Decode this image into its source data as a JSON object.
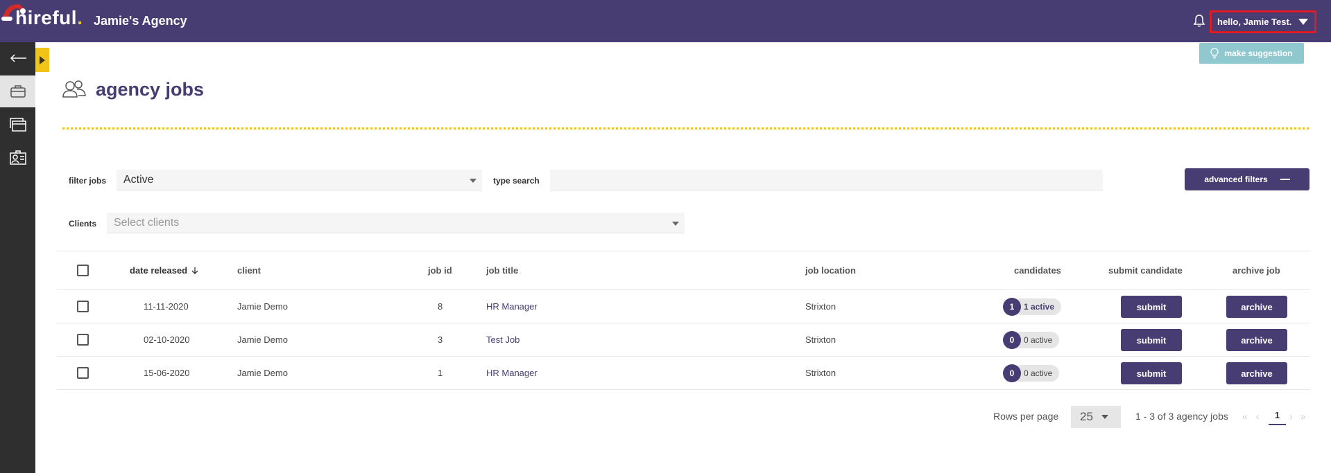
{
  "topbar": {
    "logo_text": "hireful",
    "logo_dot": ".",
    "agency_name": "Jamie's Agency",
    "user_greeting": "hello, Jamie Test."
  },
  "sidebar": {
    "items": [
      {
        "name": "back-arrow-icon"
      },
      {
        "name": "briefcase-icon",
        "active": true
      },
      {
        "name": "browser-windows-icon"
      },
      {
        "name": "id-card-icon"
      }
    ]
  },
  "suggestion_label": "make suggestion",
  "page_title": "agency jobs",
  "filters": {
    "filter_jobs_label": "filter jobs",
    "filter_jobs_value": "Active",
    "type_search_label": "type search",
    "type_search_value": "",
    "advanced_filters_label": "advanced filters",
    "clients_label": "Clients",
    "clients_placeholder": "Select clients"
  },
  "table": {
    "headers": {
      "date_released": "date released",
      "client": "client",
      "job_id": "job id",
      "job_title": "job title",
      "job_location": "job location",
      "candidates": "candidates",
      "submit_candidate": "submit candidate",
      "archive_job": "archive job"
    },
    "rows": [
      {
        "date": "11-11-2020",
        "client": "Jamie Demo",
        "job_id": "8",
        "job_title": "HR Manager",
        "location": "Strixton",
        "cand_count": "1",
        "cand_label": "1 active",
        "submit": "submit",
        "archive": "archive"
      },
      {
        "date": "02-10-2020",
        "client": "Jamie Demo",
        "job_id": "3",
        "job_title": "Test Job",
        "location": "Strixton",
        "cand_count": "0",
        "cand_label": "0 active",
        "submit": "submit",
        "archive": "archive"
      },
      {
        "date": "15-06-2020",
        "client": "Jamie Demo",
        "job_id": "1",
        "job_title": "HR Manager",
        "location": "Strixton",
        "cand_count": "0",
        "cand_label": "0 active",
        "submit": "submit",
        "archive": "archive"
      }
    ]
  },
  "pagination": {
    "rows_per_page_label": "Rows per page",
    "rows_per_page_value": "25",
    "range_text": "1 - 3 of 3 agency jobs",
    "first": "«",
    "prev": "‹",
    "current_page": "1",
    "next": "›",
    "last": "»"
  },
  "colors": {
    "brand_purple": "#473d72",
    "accent_yellow": "#f0c419",
    "suggest_teal": "#8fc9cf",
    "sidebar_dark": "#2f2f2f"
  }
}
